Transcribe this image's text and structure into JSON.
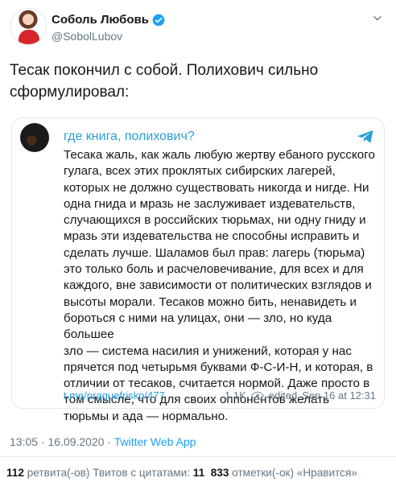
{
  "header": {
    "name": "Соболь Любовь",
    "handle": "@SobolLubov",
    "avatar_icon": "profile-photo",
    "verified_icon": "verified-badge-icon",
    "menu_icon": "chevron-down-icon"
  },
  "tweet": {
    "line1": "Тесак покончил с собой. Полихович сильно",
    "line2": "сформулировал:"
  },
  "embed": {
    "title": "где книга, полихович?",
    "source_icon": "telegram-icon",
    "lines": [
      "Тесака жаль, как жаль любую жертву ебаного русского",
      "гулага, всех этих проклятых сибирских лагерей,",
      "которых не должно существовать никогда и нигде. Ни",
      "одна гнида и мразь не заслуживает издевательств,",
      "случающихся в российских тюрьмах, ни одну гниду и",
      "мразь эти издевательства не способны исправить и",
      "сделать лучше. Шаламов был прав: лагерь (тюрьма)",
      "это только боль и расчеловечивание, для всех и для",
      "каждого, вне зависимости от политических взглядов и",
      "высоты морали. Тесаков можно бить, ненавидеть и",
      "бороться с ними на улицах, они — зло, но куда большее",
      "зло — система насилия и унижений, которая у нас",
      "прячется под четырьмя буквами Ф-С-И-Н, и которая, в",
      "отличии от тесаков, считается нормой. Даже просто в",
      "том смысле, что для своих оппонентов желать",
      "тюрьмы и ада — нормально."
    ],
    "link": "t.me/praguefrisko/477",
    "views": "1.1K",
    "edited": "edited",
    "date": "Sep 16 at 12:31"
  },
  "meta": {
    "time": "13:05 · 16.09.2020 · ",
    "source": "Twitter Web App"
  },
  "stats": {
    "retweets_count": "112",
    "retweets_label": " ретвита(-ов)  ",
    "quotes_label": "Твитов с цитатами: ",
    "quotes_count": "11",
    "likes_count": "833",
    "likes_label": " отметки(-ок) «Нравится»"
  },
  "colors": {
    "link_blue": "#2a9ed8",
    "twitter_blue": "#1da1f2",
    "muted": "#657786"
  }
}
